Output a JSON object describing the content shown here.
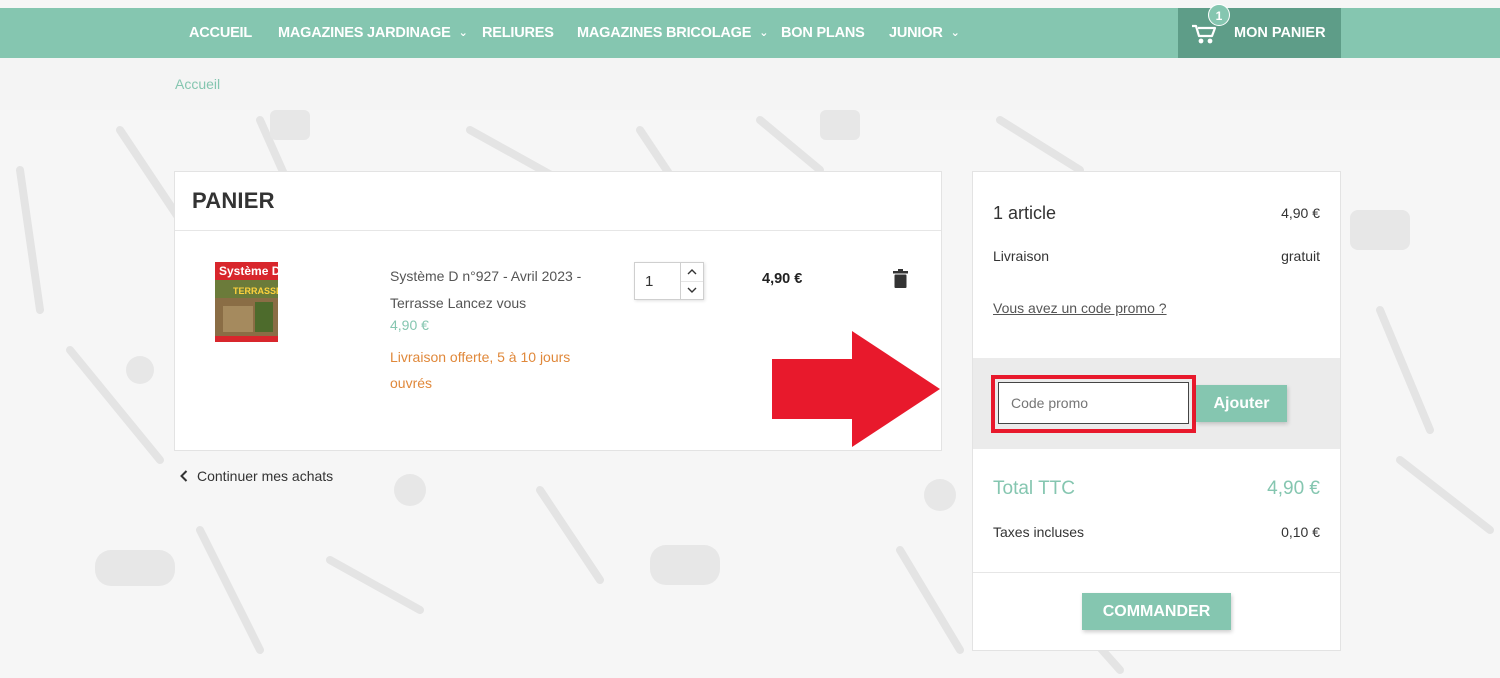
{
  "nav": {
    "items": [
      {
        "label": "ACCUEIL",
        "dropdown": false
      },
      {
        "label": "MAGAZINES JARDINAGE",
        "dropdown": true
      },
      {
        "label": "RELIURES",
        "dropdown": false
      },
      {
        "label": "MAGAZINES BRICOLAGE",
        "dropdown": true
      },
      {
        "label": "BON PLANS",
        "dropdown": false
      },
      {
        "label": "JUNIOR",
        "dropdown": true
      }
    ],
    "cart": {
      "label": "MON PANIER",
      "count": "1",
      "icon": "wheelbarrow-cart-icon"
    }
  },
  "breadcrumb": {
    "home": "Accueil"
  },
  "cart": {
    "title": "PANIER",
    "item": {
      "thumb_title": "Système D",
      "thumb_headline": "TERRASSE",
      "name": "Système D n°927 - Avril 2023 - Terrasse Lancez vous",
      "unit_price": "4,90 €",
      "shipping_note": "Livraison offerte, 5 à 10 jours ouvrés",
      "quantity": "1",
      "line_total": "4,90 €"
    },
    "continue_label": "Continuer mes achats"
  },
  "summary": {
    "count_label": "1 article",
    "count_value": "4,90 €",
    "shipping_label": "Livraison",
    "shipping_value": "gratuit",
    "promo_link": "Vous avez un code promo ?",
    "promo_placeholder": "Code promo",
    "promo_button": "Ajouter",
    "total_label": "Total TTC",
    "total_value": "4,90 €",
    "tax_label": "Taxes incluses",
    "tax_value": "0,10 €",
    "order_button": "COMMANDER"
  },
  "colors": {
    "accent": "#85c6b0",
    "accent_dark": "#5e9d88",
    "shipping_orange": "#e0883a",
    "highlight_red": "#e8192c"
  }
}
